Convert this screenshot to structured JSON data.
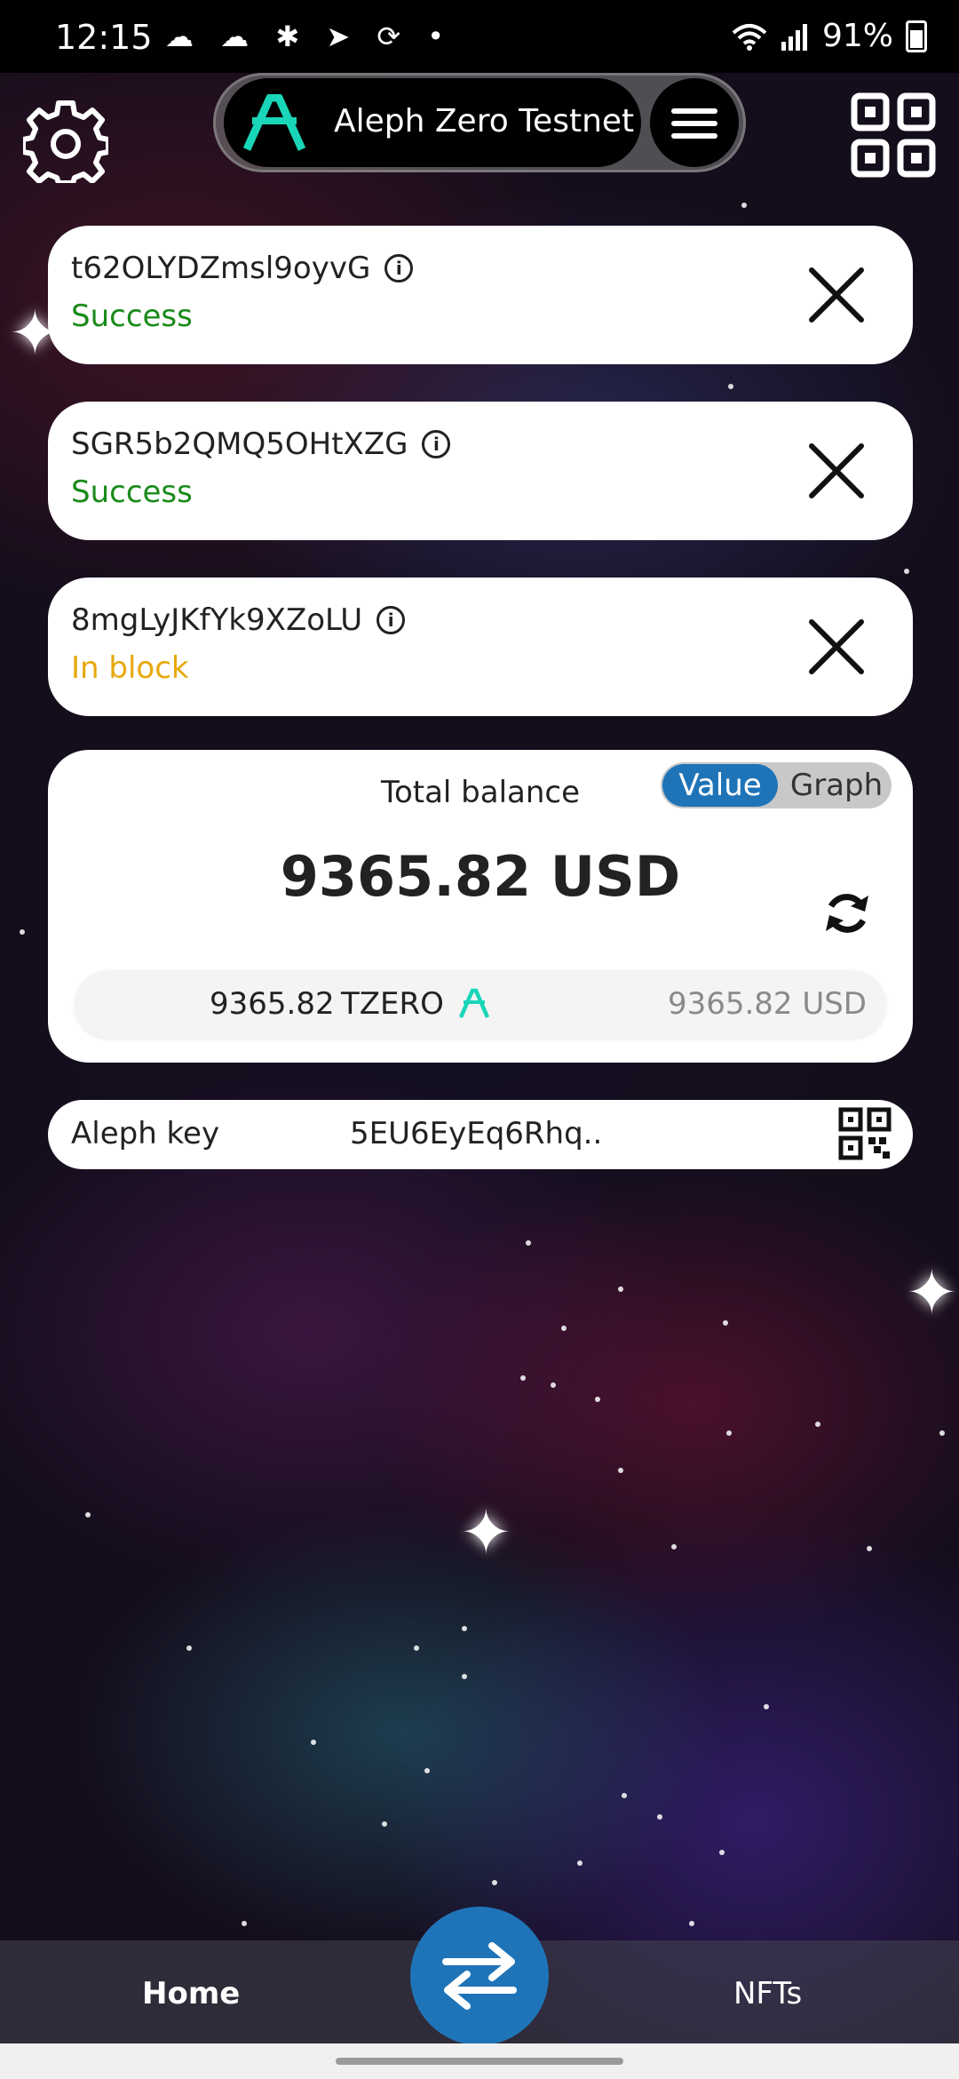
{
  "status_bar": {
    "time": "12:15",
    "notification_icons": "☁ ☁ ✱ ➤ ⟳ •",
    "battery": "91%"
  },
  "header": {
    "network_name": "Aleph Zero Testnet",
    "accent_color": "#19d6b8"
  },
  "transactions": [
    {
      "id": "t62OLYDZmsl9oyvG",
      "status": "Success",
      "status_color": "#1a8a1a"
    },
    {
      "id": "SGR5b2QMQ5OHtXZG",
      "status": "Success",
      "status_color": "#1a8a1a"
    },
    {
      "id": "8mgLyJKfYk9XZoLU",
      "status": "In block",
      "status_color": "#e8a80c"
    }
  ],
  "balance": {
    "title": "Total balance",
    "toggle_value": "Value",
    "toggle_graph": "Graph",
    "amount": "9365.82 USD",
    "token_amount": "9365.82",
    "token_symbol": "TZERO",
    "token_usd": "9365.82 USD"
  },
  "key": {
    "label": "Aleph key",
    "value": "5EU6EyEq6Rhq.."
  },
  "nav": {
    "home": "Home",
    "nfts": "NFTs"
  }
}
